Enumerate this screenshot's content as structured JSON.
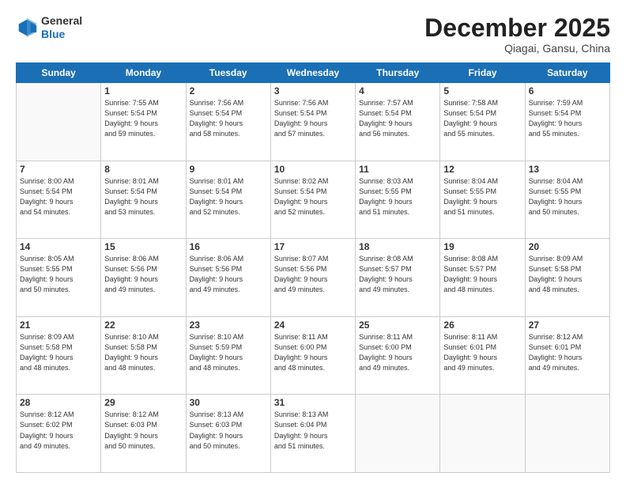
{
  "header": {
    "logo_line1": "General",
    "logo_line2": "Blue",
    "month": "December 2025",
    "location": "Qiagai, Gansu, China"
  },
  "days_of_week": [
    "Sunday",
    "Monday",
    "Tuesday",
    "Wednesday",
    "Thursday",
    "Friday",
    "Saturday"
  ],
  "weeks": [
    [
      {
        "day": "",
        "info": ""
      },
      {
        "day": "1",
        "info": "Sunrise: 7:55 AM\nSunset: 5:54 PM\nDaylight: 9 hours\nand 59 minutes."
      },
      {
        "day": "2",
        "info": "Sunrise: 7:56 AM\nSunset: 5:54 PM\nDaylight: 9 hours\nand 58 minutes."
      },
      {
        "day": "3",
        "info": "Sunrise: 7:56 AM\nSunset: 5:54 PM\nDaylight: 9 hours\nand 57 minutes."
      },
      {
        "day": "4",
        "info": "Sunrise: 7:57 AM\nSunset: 5:54 PM\nDaylight: 9 hours\nand 56 minutes."
      },
      {
        "day": "5",
        "info": "Sunrise: 7:58 AM\nSunset: 5:54 PM\nDaylight: 9 hours\nand 55 minutes."
      },
      {
        "day": "6",
        "info": "Sunrise: 7:59 AM\nSunset: 5:54 PM\nDaylight: 9 hours\nand 55 minutes."
      }
    ],
    [
      {
        "day": "7",
        "info": "Sunrise: 8:00 AM\nSunset: 5:54 PM\nDaylight: 9 hours\nand 54 minutes."
      },
      {
        "day": "8",
        "info": "Sunrise: 8:01 AM\nSunset: 5:54 PM\nDaylight: 9 hours\nand 53 minutes."
      },
      {
        "day": "9",
        "info": "Sunrise: 8:01 AM\nSunset: 5:54 PM\nDaylight: 9 hours\nand 52 minutes."
      },
      {
        "day": "10",
        "info": "Sunrise: 8:02 AM\nSunset: 5:54 PM\nDaylight: 9 hours\nand 52 minutes."
      },
      {
        "day": "11",
        "info": "Sunrise: 8:03 AM\nSunset: 5:55 PM\nDaylight: 9 hours\nand 51 minutes."
      },
      {
        "day": "12",
        "info": "Sunrise: 8:04 AM\nSunset: 5:55 PM\nDaylight: 9 hours\nand 51 minutes."
      },
      {
        "day": "13",
        "info": "Sunrise: 8:04 AM\nSunset: 5:55 PM\nDaylight: 9 hours\nand 50 minutes."
      }
    ],
    [
      {
        "day": "14",
        "info": "Sunrise: 8:05 AM\nSunset: 5:55 PM\nDaylight: 9 hours\nand 50 minutes."
      },
      {
        "day": "15",
        "info": "Sunrise: 8:06 AM\nSunset: 5:56 PM\nDaylight: 9 hours\nand 49 minutes."
      },
      {
        "day": "16",
        "info": "Sunrise: 8:06 AM\nSunset: 5:56 PM\nDaylight: 9 hours\nand 49 minutes."
      },
      {
        "day": "17",
        "info": "Sunrise: 8:07 AM\nSunset: 5:56 PM\nDaylight: 9 hours\nand 49 minutes."
      },
      {
        "day": "18",
        "info": "Sunrise: 8:08 AM\nSunset: 5:57 PM\nDaylight: 9 hours\nand 49 minutes."
      },
      {
        "day": "19",
        "info": "Sunrise: 8:08 AM\nSunset: 5:57 PM\nDaylight: 9 hours\nand 48 minutes."
      },
      {
        "day": "20",
        "info": "Sunrise: 8:09 AM\nSunset: 5:58 PM\nDaylight: 9 hours\nand 48 minutes."
      }
    ],
    [
      {
        "day": "21",
        "info": "Sunrise: 8:09 AM\nSunset: 5:58 PM\nDaylight: 9 hours\nand 48 minutes."
      },
      {
        "day": "22",
        "info": "Sunrise: 8:10 AM\nSunset: 5:58 PM\nDaylight: 9 hours\nand 48 minutes."
      },
      {
        "day": "23",
        "info": "Sunrise: 8:10 AM\nSunset: 5:59 PM\nDaylight: 9 hours\nand 48 minutes."
      },
      {
        "day": "24",
        "info": "Sunrise: 8:11 AM\nSunset: 6:00 PM\nDaylight: 9 hours\nand 48 minutes."
      },
      {
        "day": "25",
        "info": "Sunrise: 8:11 AM\nSunset: 6:00 PM\nDaylight: 9 hours\nand 49 minutes."
      },
      {
        "day": "26",
        "info": "Sunrise: 8:11 AM\nSunset: 6:01 PM\nDaylight: 9 hours\nand 49 minutes."
      },
      {
        "day": "27",
        "info": "Sunrise: 8:12 AM\nSunset: 6:01 PM\nDaylight: 9 hours\nand 49 minutes."
      }
    ],
    [
      {
        "day": "28",
        "info": "Sunrise: 8:12 AM\nSunset: 6:02 PM\nDaylight: 9 hours\nand 49 minutes."
      },
      {
        "day": "29",
        "info": "Sunrise: 8:12 AM\nSunset: 6:03 PM\nDaylight: 9 hours\nand 50 minutes."
      },
      {
        "day": "30",
        "info": "Sunrise: 8:13 AM\nSunset: 6:03 PM\nDaylight: 9 hours\nand 50 minutes."
      },
      {
        "day": "31",
        "info": "Sunrise: 8:13 AM\nSunset: 6:04 PM\nDaylight: 9 hours\nand 51 minutes."
      },
      {
        "day": "",
        "info": ""
      },
      {
        "day": "",
        "info": ""
      },
      {
        "day": "",
        "info": ""
      }
    ]
  ]
}
